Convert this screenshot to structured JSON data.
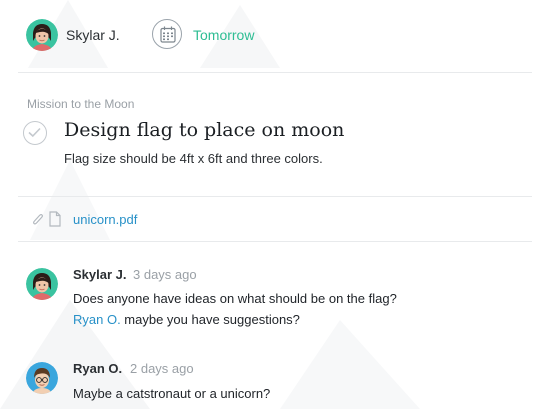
{
  "task": {
    "assignee": {
      "name": "Skylar J."
    },
    "due": {
      "label": "Tomorrow"
    },
    "project": "Mission to the Moon",
    "title": "Design flag to place on moon",
    "description": "Flag size should be 4ft x 6ft and three colors.",
    "attachment": {
      "filename": "unicorn.pdf"
    }
  },
  "comments": [
    {
      "author": "Skylar J.",
      "time": "3 days ago",
      "text_line1": "Does anyone have ideas on what should be on the flag?",
      "mention": "Ryan O.",
      "text_after_mention": " maybe you have suggestions?"
    },
    {
      "author": "Ryan O.",
      "time": "2 days ago",
      "text_line1": "Maybe a catstronaut or a unicorn?"
    }
  ],
  "colors": {
    "accent_green": "#2dbd93",
    "link_blue": "#2891c8",
    "muted_gray": "#9aa0a6",
    "avatar_skylar_bg": "#3ac3a0",
    "avatar_ryan_bg": "#3aa6dd"
  },
  "icons": [
    "calendar-icon",
    "checkmark-icon",
    "paperclip-icon",
    "file-icon"
  ]
}
